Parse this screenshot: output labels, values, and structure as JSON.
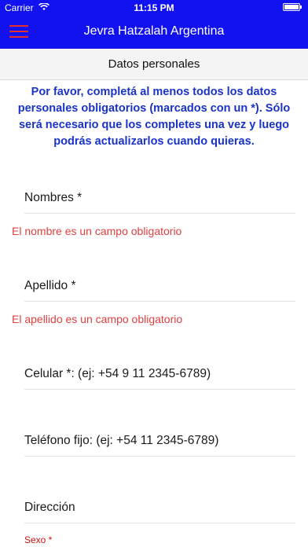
{
  "status_bar": {
    "carrier": "Carrier",
    "time": "11:15 PM",
    "wifi_icon": "wifi-icon",
    "battery_icon": "battery-icon"
  },
  "nav": {
    "title": "Jevra Hatzalah Argentina",
    "menu_icon": "hamburger-menu-icon"
  },
  "section": {
    "title": "Datos personales"
  },
  "intro": {
    "text": "Por favor, completá al menos todos los datos personales obligatorios (marcados con un *). Sólo será necesario que los completes una vez y luego podrás actualizarlos cuando quieras."
  },
  "form": {
    "nombres_placeholder": "Nombres *",
    "nombres_error": "El nombre es un campo obligatorio",
    "apellido_placeholder": "Apellido *",
    "apellido_error": "El apellido es un campo obligatorio",
    "celular_placeholder": "Celular *: (ej: +54 9 11 2345-6789)",
    "telefono_placeholder": "Teléfono fijo: (ej: +54 11 2345-6789)",
    "direccion_placeholder": "Dirección",
    "sexo_label": "Sexo *"
  },
  "colors": {
    "nav_blue": "#1212f0",
    "intro_blue": "#1a33c7",
    "error_red": "#e04040",
    "menu_red": "#e0302f"
  }
}
